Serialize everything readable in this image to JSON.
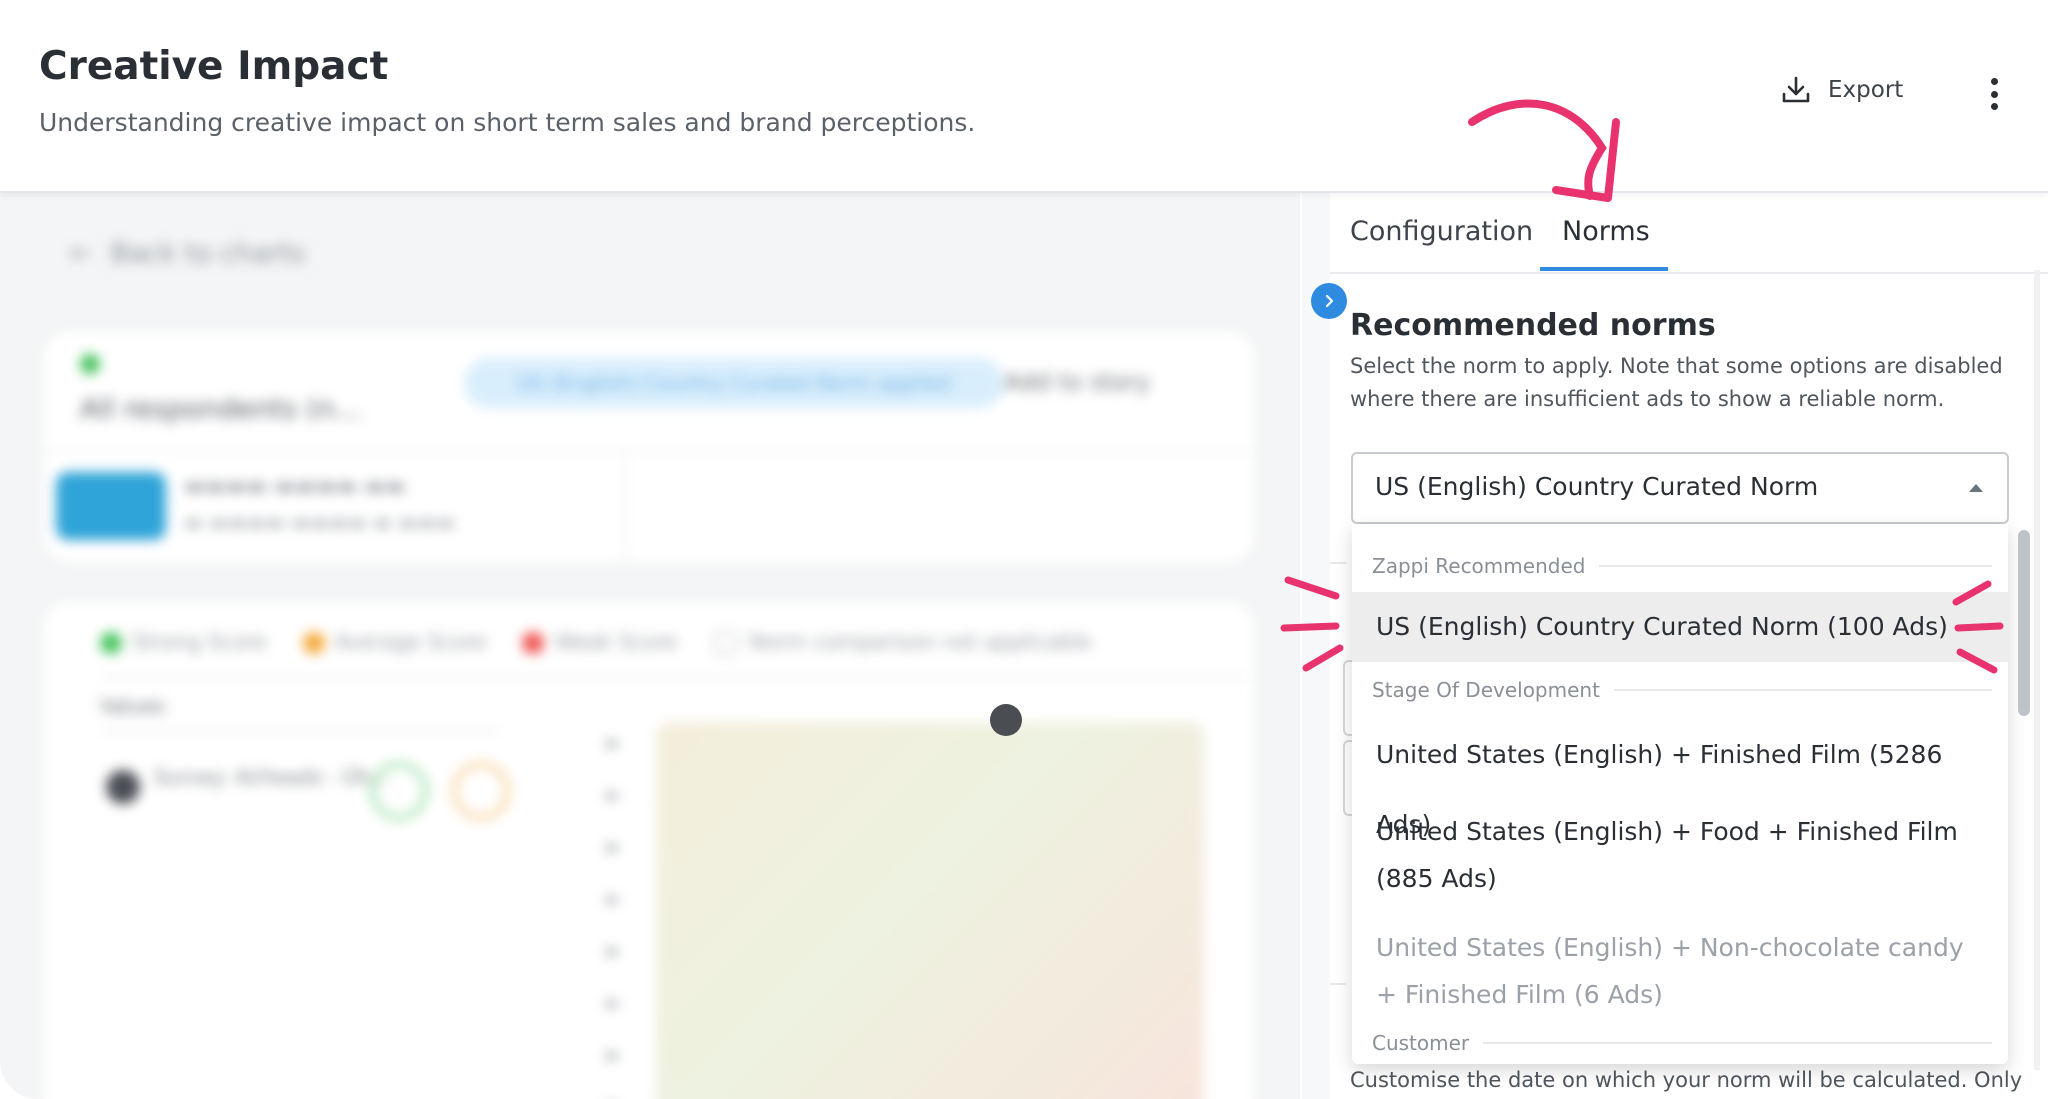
{
  "header": {
    "title": "Creative Impact",
    "subtitle": "Understanding creative impact on short term sales and brand perceptions.",
    "export_label": "Export"
  },
  "left_blurred": {
    "back_link": "Back to charts",
    "respondents": "All respondents (n...",
    "norm_pill": "US (English) Country Curated Norm applied",
    "add_to_story": "Add to story",
    "legend": [
      "Strong Score",
      "Average Score",
      "Weak Score",
      "Norm comparison not applicable"
    ],
    "values_label": "Values",
    "survey_name": "Survey: Airheads - Oh..."
  },
  "panel": {
    "tabs": [
      {
        "label": "Configuration",
        "active": false
      },
      {
        "label": "Norms",
        "active": true
      }
    ],
    "section_title": "Recommended norms",
    "section_description": "Select the norm to apply. Note that some options are disabled where there are insufficient ads to show a reliable norm.",
    "select": {
      "value": "US (English) Country Curated Norm"
    },
    "dropdown": {
      "groups": [
        {
          "label": "Zappi Recommended"
        },
        {
          "label": "Stage Of Development"
        },
        {
          "label": "Customer"
        }
      ],
      "options": [
        {
          "label": "US (English) Country Curated Norm (100 Ads)",
          "selected": true,
          "disabled": false
        },
        {
          "label": "United States (English) + Finished Film (5286 Ads)",
          "selected": false,
          "disabled": false
        },
        {
          "label": "United States (English) + Food + Finished Film (885 Ads)",
          "selected": false,
          "disabled": false
        },
        {
          "label": "United States (English) + Non-chocolate candy + Finished Film (6 Ads)",
          "selected": false,
          "disabled": true
        }
      ]
    },
    "bottom_text": "Customise the date on which your norm will be calculated. Only"
  },
  "colors": {
    "accent": "#2f8be0",
    "annotation": "#e8336f",
    "selected_bg": "#ededee"
  }
}
